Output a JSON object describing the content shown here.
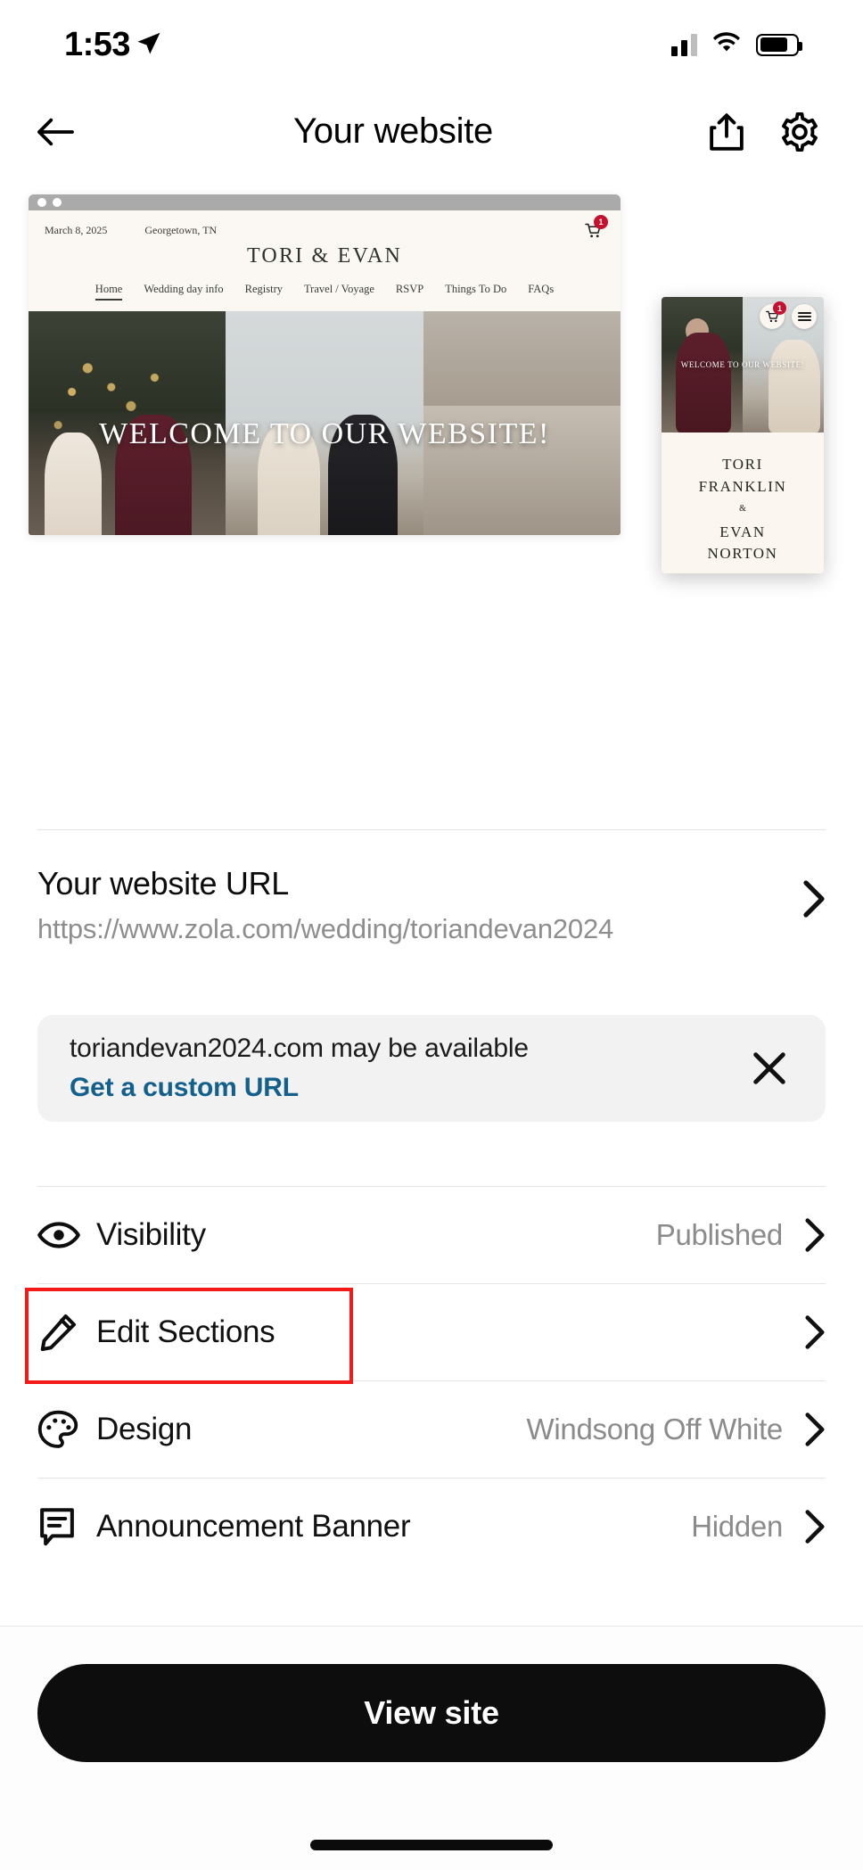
{
  "status_bar": {
    "time": "1:53",
    "location_icon": "location-arrow-icon",
    "signal_icon": "cellular-signal-icon",
    "wifi_icon": "wifi-icon",
    "battery_icon": "battery-icon"
  },
  "header": {
    "back_icon": "back-arrow-icon",
    "title": "Your website",
    "share_icon": "share-icon",
    "settings_icon": "gear-icon"
  },
  "preview": {
    "browser": {
      "date": "March 8, 2025",
      "location": "Georgetown, TN",
      "site_title": "TORI & EVAN",
      "cart_badge": "1",
      "nav": [
        {
          "label": "Home",
          "active": true
        },
        {
          "label": "Wedding day info",
          "active": false
        },
        {
          "label": "Registry",
          "active": false
        },
        {
          "label": "Travel / Voyage",
          "active": false
        },
        {
          "label": "RSVP",
          "active": false
        },
        {
          "label": "Things To Do",
          "active": false
        },
        {
          "label": "FAQs",
          "active": false
        }
      ],
      "hero_headline": "WELCOME TO OUR WEBSITE!"
    },
    "mobile": {
      "headline": "WELCOME TO OUR WEBSITE!",
      "cart_badge": "1",
      "name_first": "TORI",
      "name_first_last": "FRANKLIN",
      "ampersand": "&",
      "name_second": "EVAN",
      "name_second_last": "NORTON"
    }
  },
  "url_section": {
    "label": "Your website URL",
    "value": "https://www.zola.com/wedding/toriandevan2024",
    "chevron_icon": "chevron-right-icon"
  },
  "custom_url_banner": {
    "message": "toriandevan2024.com may be available",
    "link": "Get a custom URL",
    "close_icon": "close-icon"
  },
  "settings_rows": [
    {
      "label": "Visibility",
      "value": "Published",
      "icon": "eye-icon",
      "highlighted": false
    },
    {
      "label": "Edit Sections",
      "value": "",
      "icon": "pencil-icon",
      "highlighted": true
    },
    {
      "label": "Design",
      "value": "Windsong Off White",
      "icon": "palette-icon",
      "highlighted": false
    },
    {
      "label": "Announcement Banner",
      "value": "Hidden",
      "icon": "speech-bubble-icon",
      "highlighted": false
    }
  ],
  "bottom": {
    "cta_label": "View site"
  },
  "colors": {
    "accent_link": "#13608c",
    "highlight_box": "#f41a1a",
    "badge_red": "#c5102e",
    "cta_background": "#0d0d0d"
  }
}
